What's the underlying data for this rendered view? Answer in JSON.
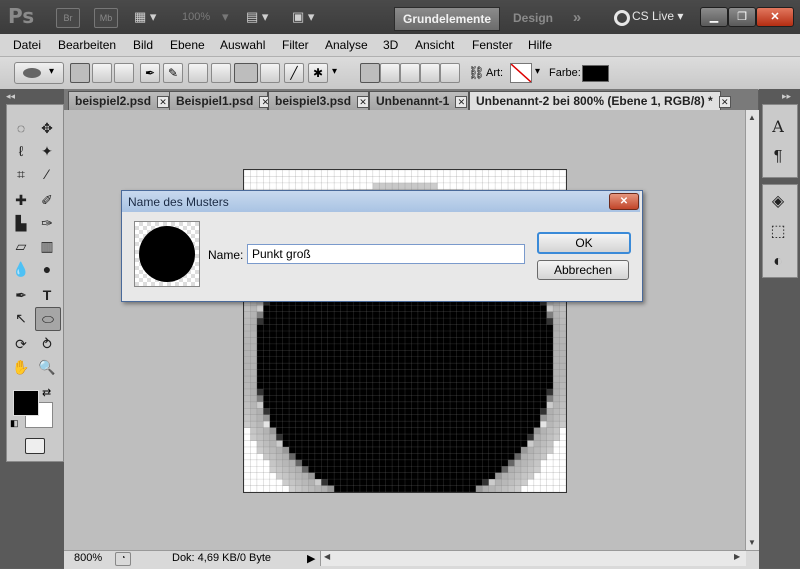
{
  "app": {
    "logo": "Ps",
    "mini_bridge": "Br",
    "mini_bridge2": "Mb",
    "zoom": "100%",
    "workspace_active": "Grundelemente",
    "workspace_design": "Design",
    "workspace_more": "»",
    "cs_live": "CS Live"
  },
  "menu": [
    "Datei",
    "Bearbeiten",
    "Bild",
    "Ebene",
    "Auswahl",
    "Filter",
    "Analyse",
    "3D",
    "Ansicht",
    "Fenster",
    "Hilfe"
  ],
  "options": {
    "art_label": "Art:",
    "farbe_label": "Farbe:",
    "farbe_color": "#000000"
  },
  "tabs": [
    {
      "label": "beispiel2.psd"
    },
    {
      "label": "Beispiel1.psd"
    },
    {
      "label": "beispiel3.psd"
    },
    {
      "label": "Unbenannt-1"
    },
    {
      "label": "Unbenannt-2 bei 800% (Ebene 1, RGB/8) *"
    }
  ],
  "status": {
    "zoom": "800%",
    "doc": "Dok: 4,69 KB/0 Byte"
  },
  "dialog": {
    "title": "Name des Musters",
    "name_label": "Name:",
    "name_value": "Punkt groß",
    "ok": "OK",
    "cancel": "Abbrechen"
  },
  "icons": {
    "close": "✕",
    "text_panel": "A",
    "paragraph_panel": "¶"
  }
}
